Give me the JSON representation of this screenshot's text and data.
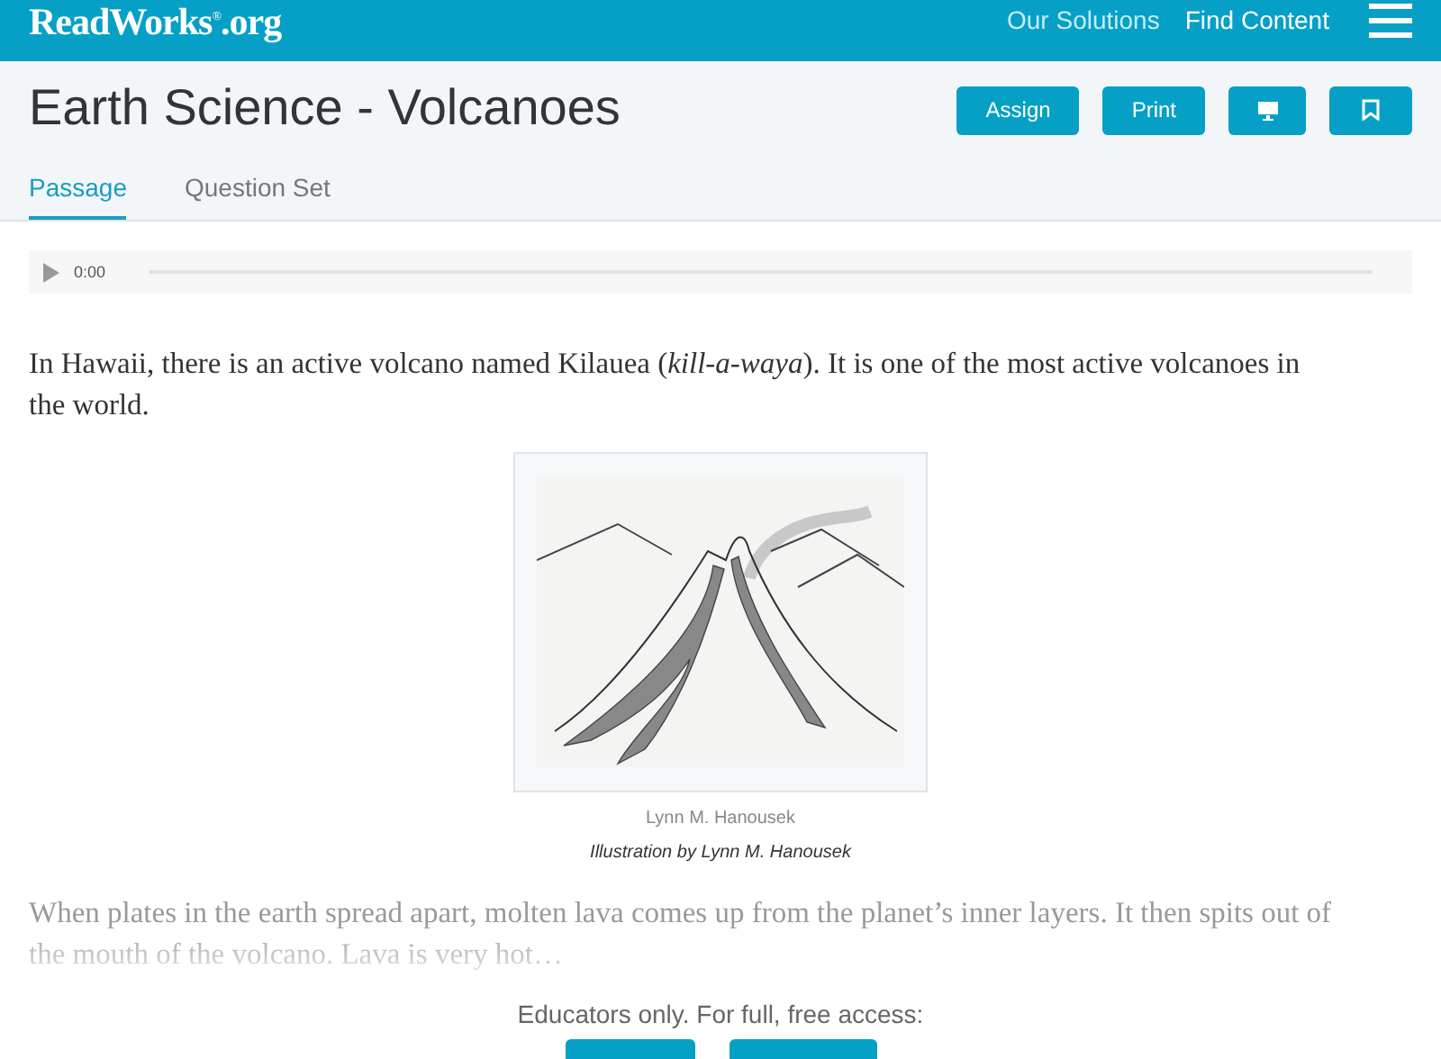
{
  "header": {
    "logo": "ReadWorks$^{®}$.org",
    "nav": [
      "Our Solutions",
      "Find Content"
    ]
  },
  "title": "Earth Science - Volcanoes",
  "actions": [
    {
      "kind": "text",
      "label": "Assign"
    },
    {
      "kind": "text",
      "label": "Print"
    },
    {
      "kind": "monitor"
    },
    {
      "kind": "bookmark"
    }
  ],
  "tabs": [
    {
      "label": "Passage",
      "selected": true
    },
    {
      "label": "Question Set",
      "selected": false
    }
  ],
  "audio": {
    "time": "0:00"
  },
  "paragraph": "In Hawaii, there is an active volcano named Kilauea (*kill-a-waya*). It is one of the most active volcanoes in the world.",
  "figure": {
    "credit": "Lynn M. Hanousek",
    "caption": "Illustration by Lynn M. Hanousek"
  },
  "faded_paragraph": "When plates in the earth spread apart, molten lava comes up from the planet’s inner layers. It then spits out of the mouth of the volcano. Lava is very hot…",
  "access": {
    "message": "Educators only. For full, free access:"
  }
}
